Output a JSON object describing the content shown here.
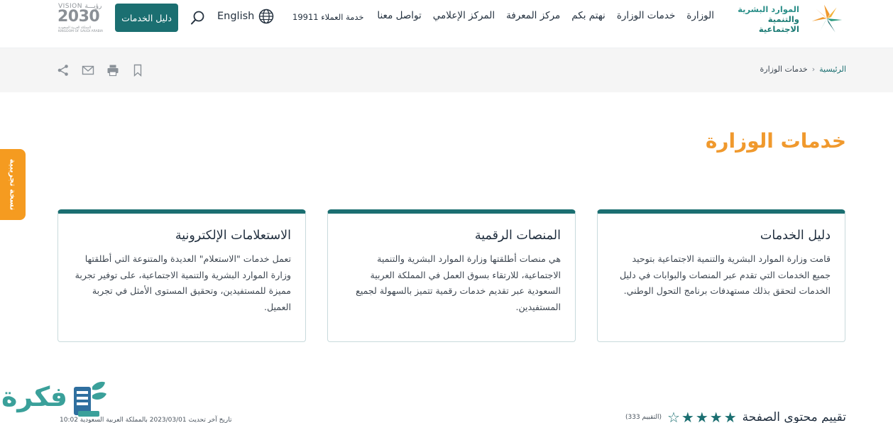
{
  "header": {
    "logo": {
      "line1": "الموارد البشرية",
      "line2": "والتنمية الاجتماعية"
    },
    "nav": [
      "الوزارة",
      "خدمات الوزارة",
      "نهتم بكم",
      "مركز المعرفة",
      "المركز الإعلامي",
      "تواصل معنا"
    ],
    "customer_service": "خدمة العملاء 19911",
    "language": "English",
    "guide_button": "دليل الخدمات",
    "vision": {
      "top": "VISION رؤيـــة",
      "year": "2030",
      "sub": "المملكة العربية السعودية KINGDOM OF SAUDI ARABIA"
    }
  },
  "breadcrumb": {
    "home": "الرئيسية",
    "separator": "‹",
    "current": "خدمات الوزارة"
  },
  "tools": [
    "bookmark-icon",
    "print-icon",
    "mail-icon",
    "share-icon"
  ],
  "page_title": "خدمات الوزارة",
  "side_tab": "نسخة تجريبية",
  "cards": [
    {
      "title": "دليل الخدمات",
      "body": "قامت وزارة الموارد البشرية والتنمية الاجتماعية بتوحيد جميع الخدمات التي تقدم عبر المنصات والبوابات في دليل الخدمات لتحقق بذلك مستهدفات برنامج التحول الوطني."
    },
    {
      "title": "المنصات الرقمية",
      "body": "هي منصات أطلقتها وزارة الموارد البشرية والتنمية الاجتماعية، للارتقاء بسوق العمل في المملكة العربية السعودية عبر تقديم خدمات رقمية تتميز بالسهولة لجميع المستفيدين."
    },
    {
      "title": "الاستعلامات الإلكترونية",
      "body": "تعمل خدمات \"الاستعلام\" العديدة والمتنوعة التي أطلقتها وزارة الموارد البشرية والتنمية الاجتماعية، على توفير تجربة مميزة للمستفيدين، وتحقيق المستوى الأمثل في تجربة العميل."
    }
  ],
  "rating": {
    "label": "تقييم محتوى الصفحة",
    "stars_filled": 4,
    "stars_total": 5,
    "count": "(التقييم 333)"
  },
  "last_update": "تاريخ آخر تحديث 2023/03/01 بالمملكة العربية السعودية 10:02",
  "watermark": "فكرة",
  "colors": {
    "teal": "#1b6f71",
    "orange": "#f0992d",
    "tab": "#f59b20"
  }
}
